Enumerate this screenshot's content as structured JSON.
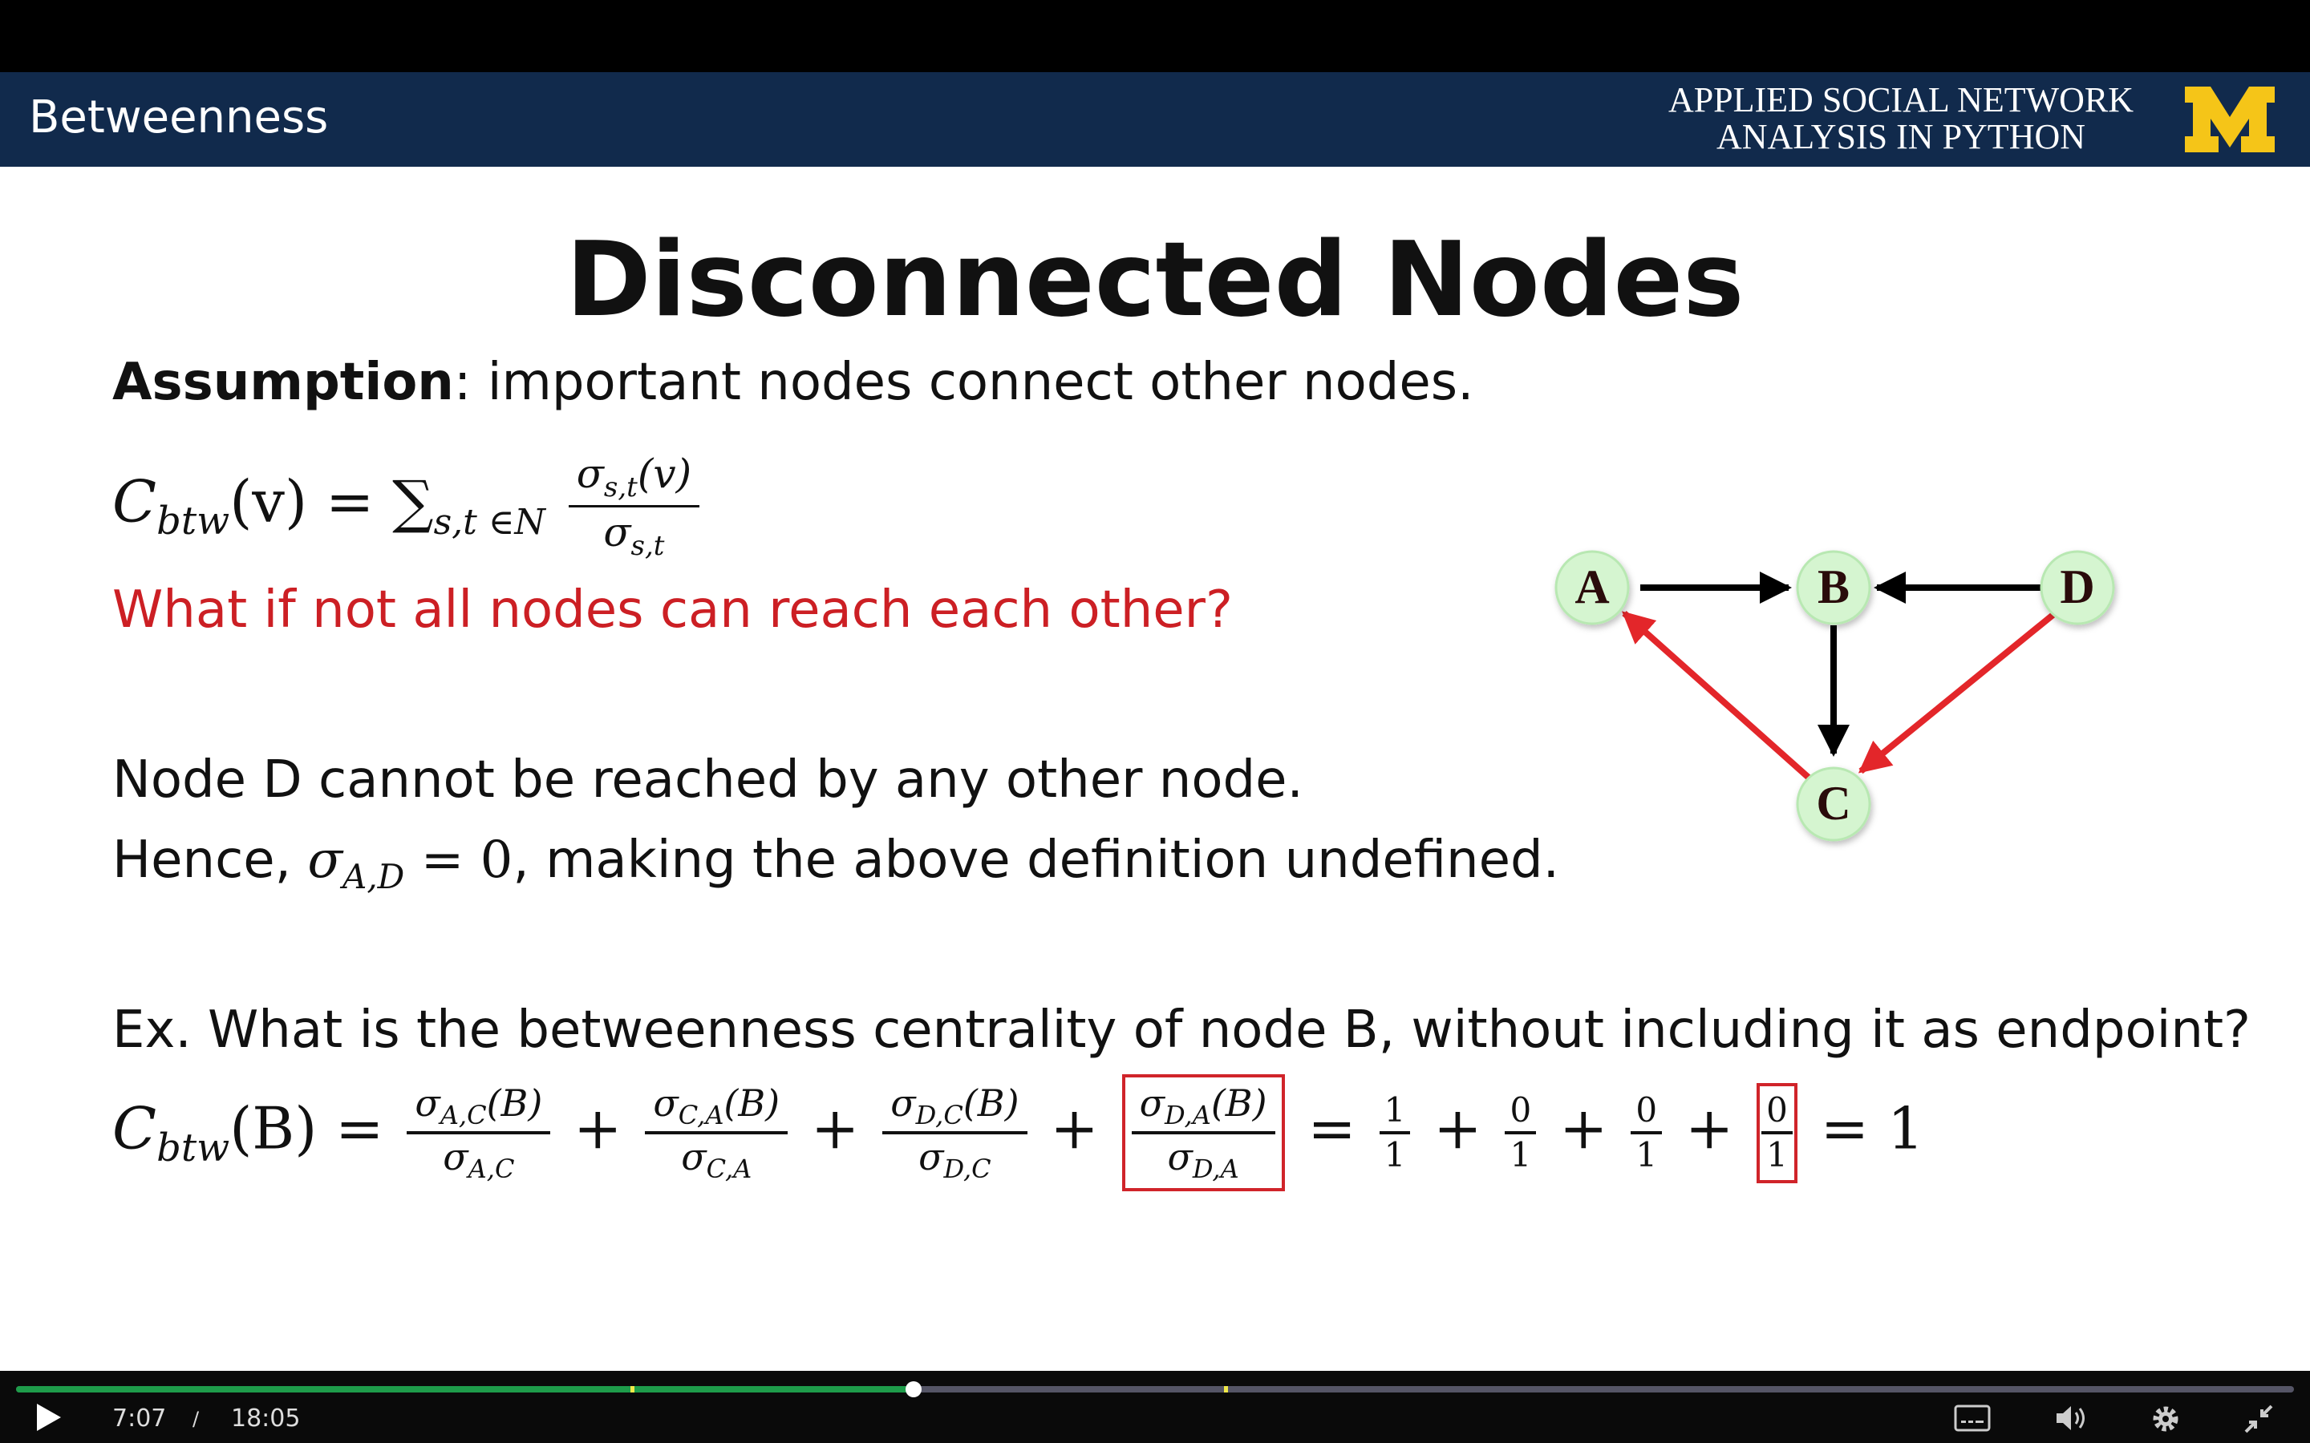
{
  "header": {
    "section": "Betweenness",
    "course_line1": "APPLIED SOCIAL NETWORK",
    "course_line2": "ANALYSIS IN PYTHON",
    "logo_letter": "M"
  },
  "slide": {
    "title": "Disconnected Nodes",
    "assumption_label": "Assumption",
    "assumption_text": ": important nodes connect other nodes.",
    "formula_lhs": "C",
    "formula_lhs_sub": "btw",
    "formula_arg": "(v) = ",
    "formula_sum": "∑",
    "formula_sum_sub": "s,t ∈N",
    "formula_num": "σ",
    "formula_num_sub": "s,t",
    "formula_num_arg": "(v)",
    "formula_den": "σ",
    "formula_den_sub": "s,t",
    "question": "What if not all nodes can reach each other?",
    "reach_text": "Node D cannot be reached by any other node.",
    "hence_prefix": "Hence, ",
    "hence_sigma": "σ",
    "hence_sigma_sub": "A,D",
    "hence_eq": " = 0",
    "hence_suffix": ", making the above definition undefined.",
    "example_text": "Ex. What is the betweenness centrality of node B, without including it as endpoint?",
    "example_lhs": "C",
    "example_lhs_sub": "btw",
    "example_lhs_arg": "(B) = ",
    "terms": [
      {
        "num_sub": "A,C",
        "den_sub": "A,C"
      },
      {
        "num_sub": "C,A",
        "den_sub": "C,A"
      },
      {
        "num_sub": "D,C",
        "den_sub": "D,C"
      },
      {
        "num_sub": "D,A",
        "den_sub": "D,A"
      }
    ],
    "sigma": "σ",
    "term_arg": "(B)",
    "plus": "+",
    "equals": "=",
    "values": [
      {
        "num": "1",
        "den": "1"
      },
      {
        "num": "0",
        "den": "1"
      },
      {
        "num": "0",
        "den": "1"
      },
      {
        "num": "0",
        "den": "1"
      }
    ],
    "result": "1"
  },
  "graph": {
    "nodes": [
      "A",
      "B",
      "C",
      "D"
    ],
    "edge_color_black": "#000000",
    "edge_color_red": "#e3262a",
    "node_fill": "#d5f5d0"
  },
  "player": {
    "current_time": "7:07",
    "separator": "/",
    "duration": "18:05",
    "progress": 0.394
  }
}
